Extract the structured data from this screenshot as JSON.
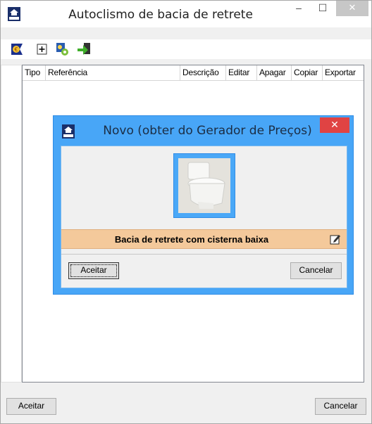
{
  "window": {
    "title": "Autoclismo de bacia de retrete",
    "app_icon": "mep-house-icon",
    "controls": {
      "minimize": "–",
      "maximize": "☐",
      "close": "✕"
    }
  },
  "toolbar": {
    "buttons": [
      {
        "name": "euro-price-icon"
      },
      {
        "name": "add-icon"
      },
      {
        "name": "gears-icon"
      },
      {
        "name": "import-arrow-icon"
      }
    ]
  },
  "table": {
    "columns": [
      "Tipo",
      "Referência",
      "Descrição",
      "Editar",
      "Apagar",
      "Copiar",
      "Exportar"
    ]
  },
  "footer": {
    "accept_label": "Aceitar",
    "cancel_label": "Cancelar"
  },
  "dialog": {
    "title": "Novo (obter do Gerador de Preços)",
    "close": "✕",
    "image": "toilet-photo",
    "description": "Bacia de retrete com cisterna baixa",
    "accept_label": "Aceitar",
    "cancel_label": "Cancelar"
  },
  "colors": {
    "dialog_accent": "#48a6f7",
    "description_bar": "#f4c99b",
    "close_red": "#e04343",
    "euro_strip_border": "#e0e0e0"
  }
}
